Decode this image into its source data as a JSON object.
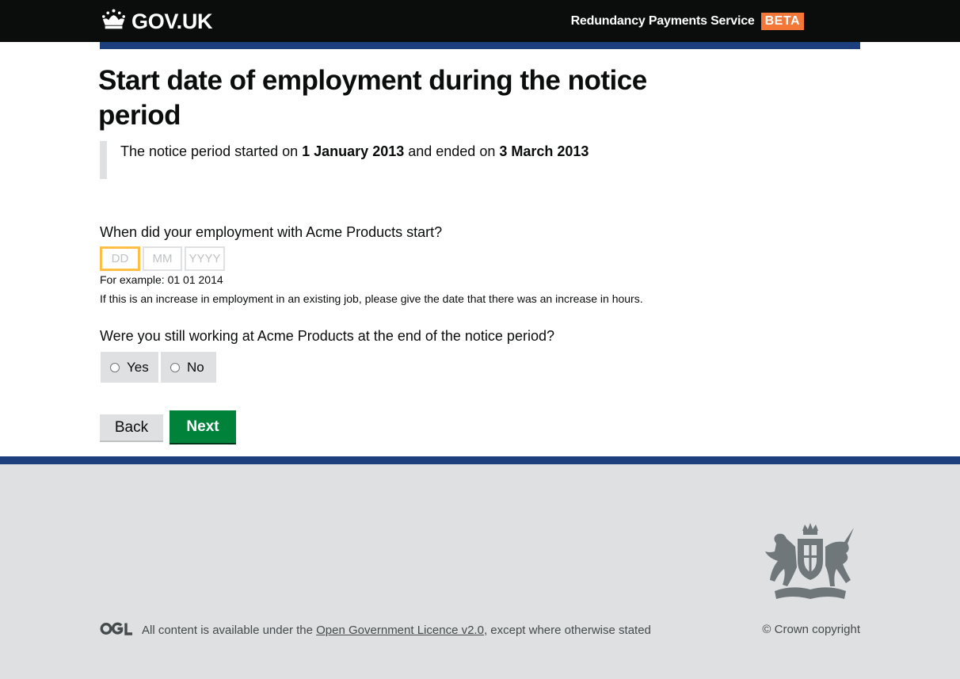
{
  "header": {
    "logo_text": "GOV.UK",
    "service_name": "Redundancy Payments Service",
    "phase_badge": "BETA"
  },
  "main": {
    "title": "Start date of employment during the notice period",
    "notice": {
      "prefix": "The notice period started on ",
      "start_date": "1 January 2013",
      "middle": " and ended on ",
      "end_date": "3 March 2013"
    },
    "question_start": {
      "label": "When did your employment with Acme Products start?",
      "day_placeholder": "DD",
      "month_placeholder": "MM",
      "year_placeholder": "YYYY",
      "example": "For example: 01 01 2014",
      "hint": "If this is an increase in employment in an existing job, please give the date that there was an increase in hours."
    },
    "question_working": {
      "label": "Were you still working at Acme Products at the end of the notice period?",
      "options": [
        "Yes",
        "No"
      ]
    },
    "buttons": {
      "back": "Back",
      "next": "Next"
    }
  },
  "footer": {
    "licence_prefix": "All content is available under the ",
    "licence_link": "Open Government Licence v2.0",
    "licence_suffix": ", except where otherwise stated",
    "copyright": "© Crown copyright"
  },
  "colors": {
    "header_bg": "#0b0c0c",
    "brand_blue": "#1d3f7d",
    "beta_orange": "#f47738",
    "focus_yellow": "#ffbf47",
    "button_green": "#00823b",
    "footer_bg": "#dee0e2"
  },
  "icons": {
    "logo": "crown-icon",
    "ogl": "ogl-logo-icon",
    "crest": "royal-coat-of-arms-icon"
  }
}
